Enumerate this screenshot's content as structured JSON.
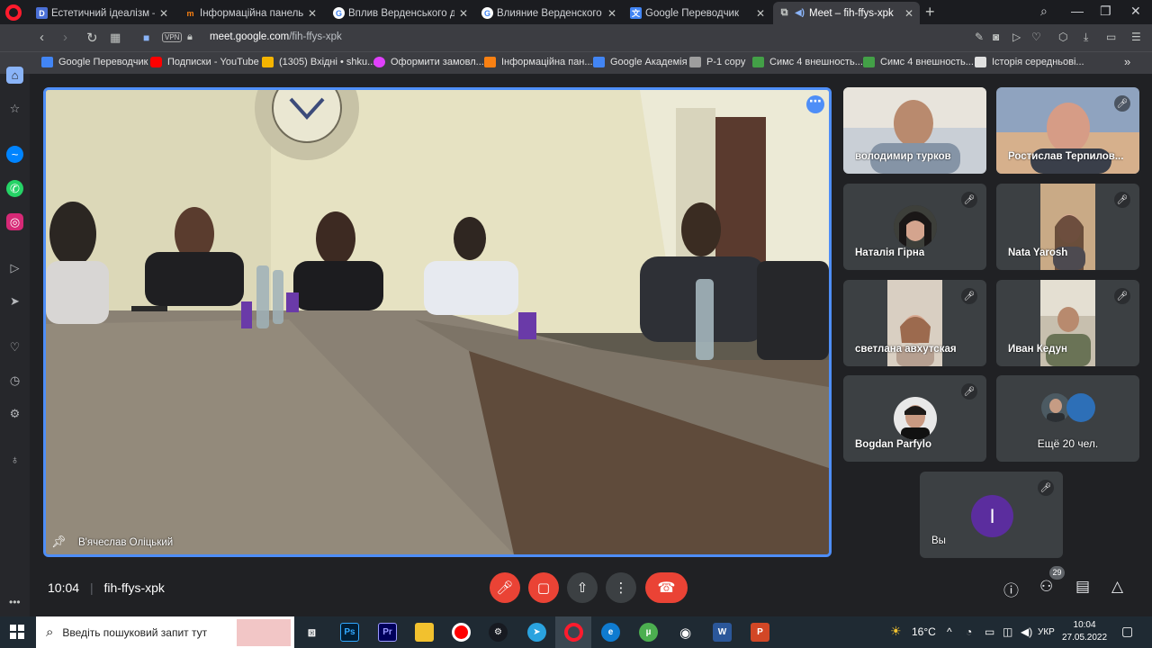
{
  "browser": {
    "tabs": [
      {
        "title": "Естетичний ідеалізм — ти",
        "icon": "dictionary-d-icon",
        "color": "#4a6fd6"
      },
      {
        "title": "Інформаційна панель",
        "icon": "moodle-m-icon",
        "color": "#f98012"
      },
      {
        "title": "Вплив Верденського дого",
        "icon": "google-g-icon",
        "color": "#ffffff"
      },
      {
        "title": "Влияние Верденского дог",
        "icon": "google-g-icon",
        "color": "#ffffff"
      },
      {
        "title": "Google Переводчик",
        "icon": "translate-icon",
        "color": "#4285f4"
      },
      {
        "title": "Meet – fih-ffys-xpk",
        "icon": "meet-icon",
        "color": "#00ac47",
        "active": true
      }
    ],
    "url_host": "meet.google.com",
    "url_path": "/fih-ffys-xpk",
    "vpn_label": "VPN",
    "bookmarks": [
      {
        "label": "Google Переводчик",
        "color": "#4285f4"
      },
      {
        "label": "Подписки - YouTube",
        "color": "#ff0000"
      },
      {
        "label": "(1305) Вхідні • shku...",
        "color": "#f4b400"
      },
      {
        "label": "Оформити замовл...",
        "color": "#e040fb"
      },
      {
        "label": "Інформаційна пан...",
        "color": "#f98012"
      },
      {
        "label": "Google Академія",
        "color": "#4285f4"
      },
      {
        "label": "P-1 copy",
        "color": "#9e9e9e"
      },
      {
        "label": "Симс 4 внешность...",
        "color": "#43a047"
      },
      {
        "label": "Симс 4 внешность...",
        "color": "#43a047"
      },
      {
        "label": "Історія середньові...",
        "color": "#e0e0e0"
      }
    ]
  },
  "meet": {
    "main_speaker": "В'ячеслав Оліцький",
    "meeting_time": "10:04",
    "meeting_code": "fih-ffys-xpk",
    "participant_count": "29",
    "tiles": [
      {
        "name": "володимир турков",
        "muted": false
      },
      {
        "name": "Ростислав Терпилов...",
        "muted": true
      },
      {
        "name": "Наталія Гірна",
        "muted": true
      },
      {
        "name": "Nata Yarosh",
        "muted": true
      },
      {
        "name": "светлана авхутская",
        "muted": true
      },
      {
        "name": "Иван Кедун",
        "muted": true
      },
      {
        "name": "Bogdan Parfylo",
        "muted": true
      },
      {
        "name": "Ещё 20 чел.",
        "muted": false
      }
    ],
    "self": {
      "name": "Вы",
      "initial": "I",
      "avatar_color": "#5b2d9e"
    }
  },
  "taskbar": {
    "search_placeholder": "Введіть пошуковий запит тут",
    "weather": "16°C",
    "language": "УКР",
    "time": "10:04",
    "date": "27.05.2022"
  }
}
